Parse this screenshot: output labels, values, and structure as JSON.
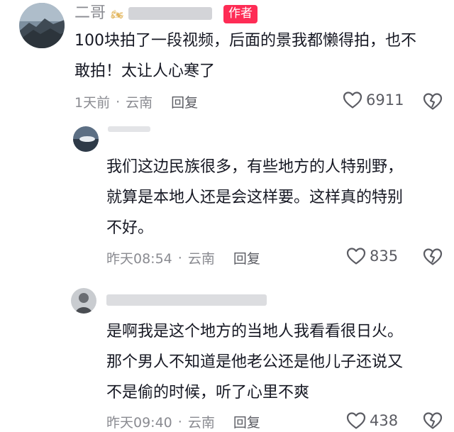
{
  "comments": [
    {
      "author_prefix": "二哥",
      "author_badge": "作者",
      "lines": [
        "100块拍了一段视频，后面的景我都懒得拍，也不",
        "敢拍！太让人心寒了"
      ],
      "time": "1天前",
      "location": "云南",
      "reply_label": "回复",
      "likes": "6911"
    },
    {
      "author_prefix": "",
      "lines": [
        "我们这边民族很多，有些地方的人特别野，",
        "就算是本地人还是会这样要。这样真的特别",
        "不好。"
      ],
      "time": "昨天08:54",
      "location": "云南",
      "reply_label": "回复",
      "likes": "835"
    },
    {
      "author_prefix": "",
      "lines": [
        "是啊我是这个地方的当地人我看看很日火。",
        "那个男人不知道是他老公还是他儿子还说又",
        "不是偷的时候，听了心里不爽"
      ],
      "time": "昨天09:40",
      "location": "云南",
      "reply_label": "回复",
      "likes": "438"
    }
  ],
  "separator": "·",
  "icons": {
    "like": "heart-outline-icon",
    "dislike": "broken-heart-icon"
  },
  "colors": {
    "badge": "#fe2c55",
    "meta": "#8a8b91",
    "text": "#161823"
  }
}
